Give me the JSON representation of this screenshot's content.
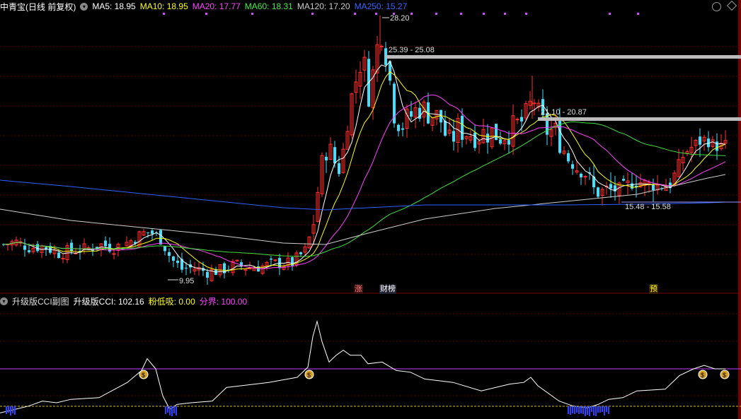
{
  "main_header": {
    "stock": "中青宝(日线 前复权)",
    "ma": [
      {
        "label": "MA5: 18.95",
        "color": "#ffffff"
      },
      {
        "label": "MA10: 18.95",
        "color": "#ffff00"
      },
      {
        "label": "MA20: 17.77",
        "color": "#ff40ff"
      },
      {
        "label": "MA60: 18.31",
        "color": "#40e040"
      },
      {
        "label": "MA120: 17.20",
        "color": "#cccccc"
      },
      {
        "label": "MA250: 15.27",
        "color": "#3060ff"
      }
    ]
  },
  "annotations": {
    "high": "28.20",
    "low": "9.95",
    "range1": "25.39 - 25.08",
    "range2": "21.10 - 20.87",
    "range3": "15.48 - 15.58"
  },
  "tags": {
    "t1": "涨",
    "t2": "财榜",
    "t3": "预"
  },
  "sub_header": {
    "title": "升级版CCI副图",
    "items": [
      {
        "label": "升级版CCI: 102.16",
        "color": "#ffffff"
      },
      {
        "label": "粉低吸: 0.00",
        "color": "#ffff00"
      },
      {
        "label": "分界: 100.00",
        "color": "#ff40ff"
      }
    ]
  },
  "colors": {
    "up": "#ff3030",
    "down": "#40e0ff",
    "bg": "#000000"
  }
}
